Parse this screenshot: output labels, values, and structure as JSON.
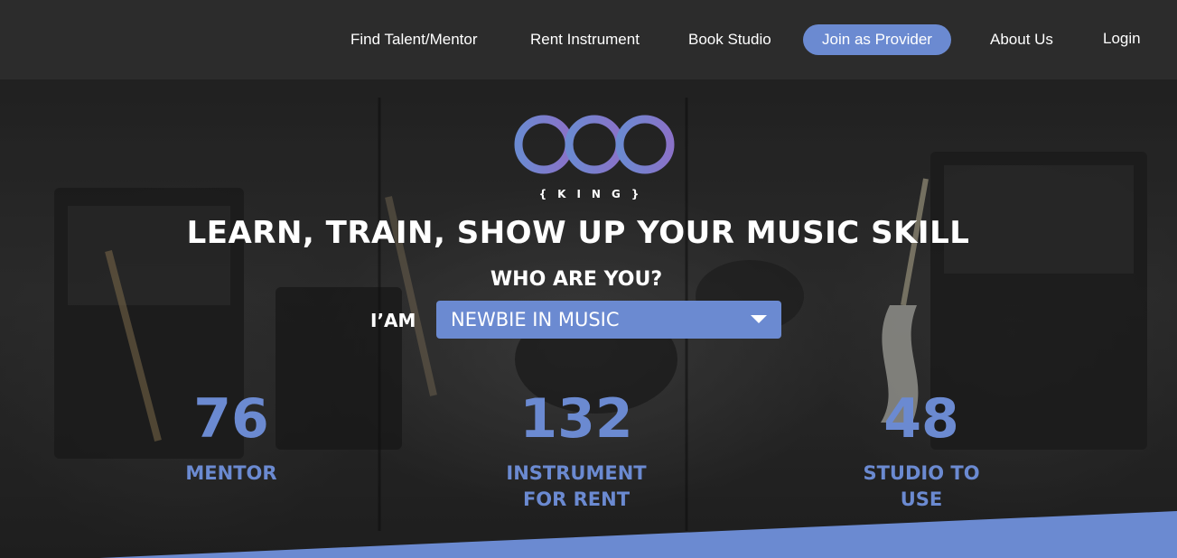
{
  "nav": {
    "items": [
      "Find Talent/Mentor",
      "Rent Instrument",
      "Book Studio"
    ],
    "cta": "Join as Provider",
    "about": "About Us",
    "login": "Login"
  },
  "logo": {
    "subtitle": "{KING}"
  },
  "hero": {
    "headline": "LEARN, TRAIN, SHOW UP YOUR MUSIC SKILL",
    "question": "WHO ARE YOU?",
    "iam_label": "I’AM",
    "select_value": "NEWBIE IN MUSIC"
  },
  "stats": [
    {
      "number": "76",
      "label_line1": "MENTOR",
      "label_line2": ""
    },
    {
      "number": "132",
      "label_line1": "INSTRUMENT",
      "label_line2": "FOR RENT"
    },
    {
      "number": "48",
      "label_line1": "STUDIO TO",
      "label_line2": "USE"
    }
  ],
  "colors": {
    "accent": "#6b8ad1",
    "navbar": "#2c2c2c",
    "text": "#ffffff"
  },
  "icons": {
    "dropdown": "triangle-down-icon",
    "logo": "dbo-logo"
  }
}
